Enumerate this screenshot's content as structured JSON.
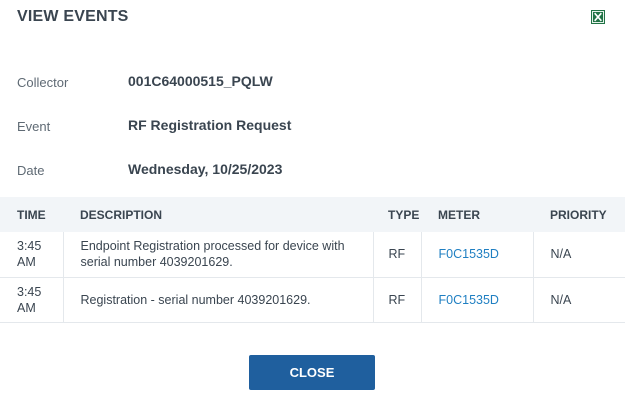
{
  "dialog": {
    "title": "VIEW EVENTS",
    "export_icon": "excel-export-icon"
  },
  "details": {
    "collector_label": "Collector",
    "collector_value": "001C64000515_PQLW",
    "event_label": "Event",
    "event_value": "RF Registration Request",
    "date_label": "Date",
    "date_value": "Wednesday, 10/25/2023"
  },
  "table": {
    "headers": {
      "time": "TIME",
      "description": "DESCRIPTION",
      "type": "TYPE",
      "meter": "METER",
      "priority": "PRIORITY"
    },
    "rows": [
      {
        "time": "3:45 AM",
        "description": "Endpoint Registration processed for device with serial number 4039201629.",
        "type": "RF",
        "meter": "F0C1535D",
        "priority": "N/A"
      },
      {
        "time": "3:45 AM",
        "description": "Registration - serial number 4039201629.",
        "type": "RF",
        "meter": "F0C1535D",
        "priority": "N/A"
      }
    ]
  },
  "footer": {
    "close_label": "CLOSE"
  },
  "colors": {
    "accent": "#1f5f9e",
    "link": "#1f7fc2",
    "header_bg": "#f2f5f8",
    "excel_green": "#217346"
  }
}
